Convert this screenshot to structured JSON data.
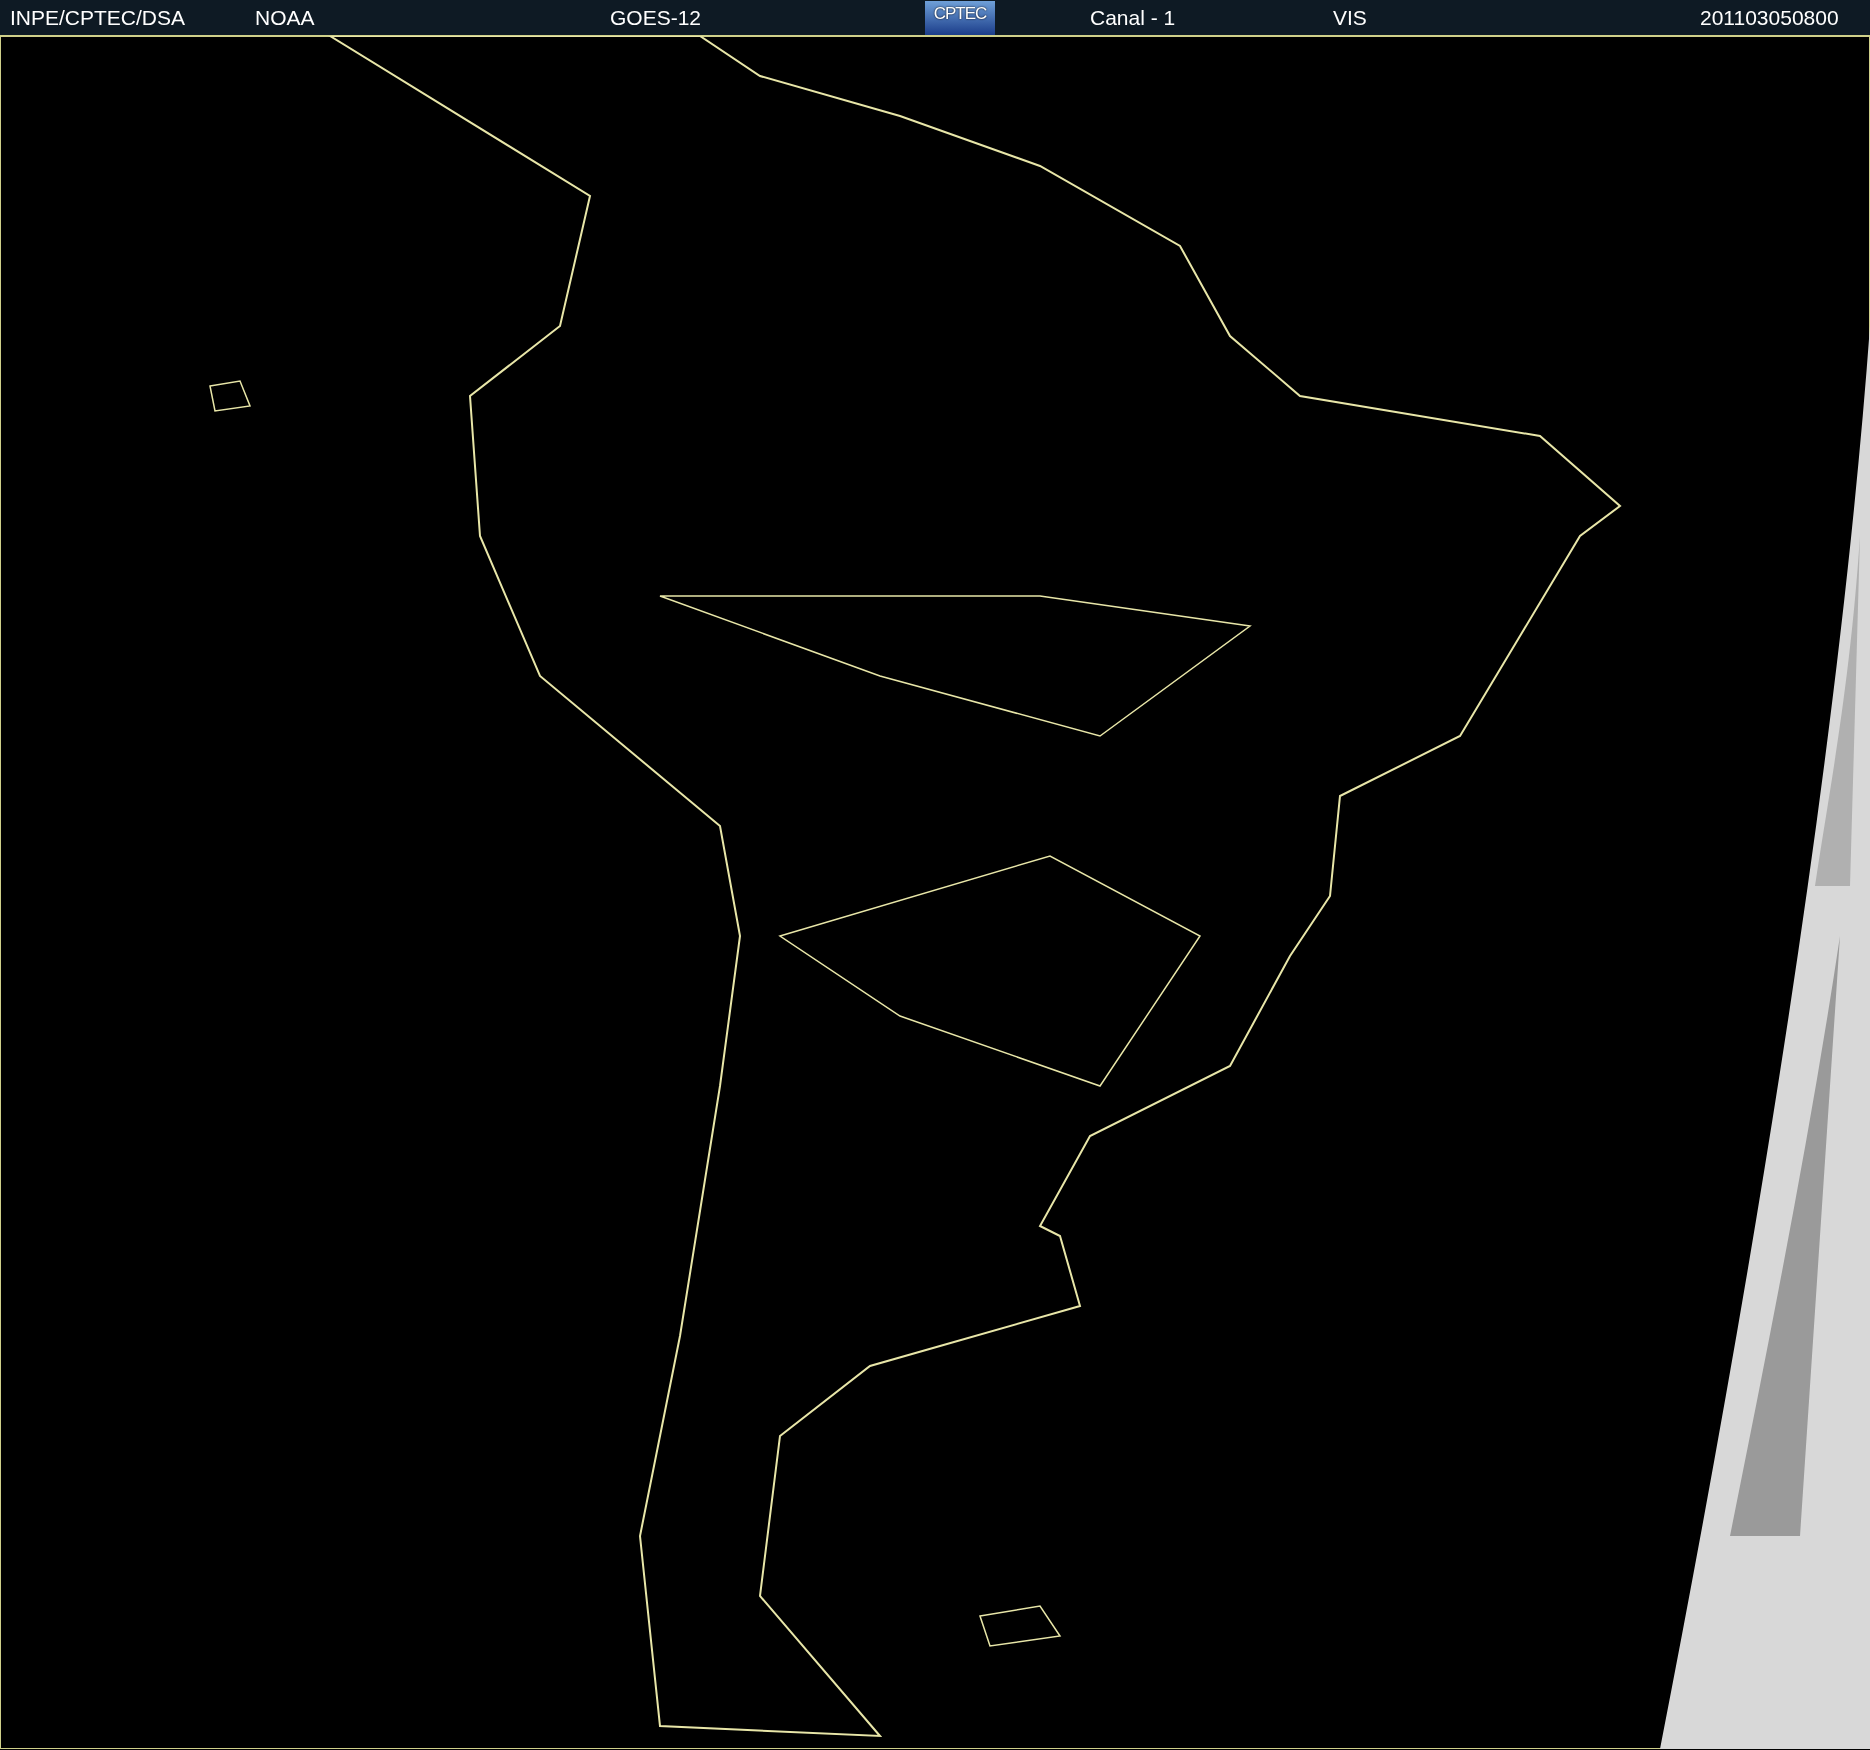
{
  "header": {
    "items": [
      {
        "kind": "text",
        "text": "INPE/CPTEC/DSA"
      },
      {
        "kind": "text",
        "text": "NOAA"
      },
      {
        "kind": "text",
        "text": "GOES-12"
      },
      {
        "kind": "logo",
        "text": "CPTEC"
      },
      {
        "kind": "text",
        "text": "Canal - 1"
      },
      {
        "kind": "text",
        "text": "VIS"
      },
      {
        "kind": "text",
        "text": "201103050800"
      }
    ]
  }
}
